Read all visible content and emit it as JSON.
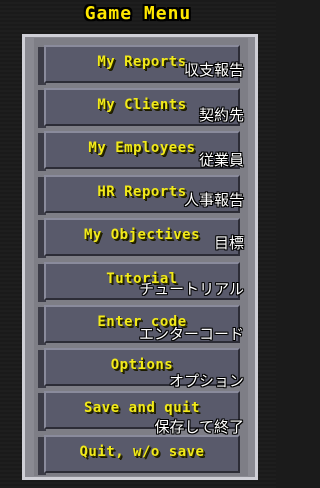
{
  "title": "Game Menu",
  "items": [
    {
      "label": "My Reports",
      "subtitle": "収支報告"
    },
    {
      "label": "My Clients",
      "subtitle": "契約先"
    },
    {
      "label": "My Employees",
      "subtitle": "従業員"
    },
    {
      "label": "HR Reports",
      "subtitle": "人事報告"
    },
    {
      "label": "My Objectives",
      "subtitle": "目標"
    },
    {
      "label": "Tutorial",
      "subtitle": "チュートリアル"
    },
    {
      "label": "Enter code",
      "subtitle": "エンターコード"
    },
    {
      "label": "Options",
      "subtitle": "オプション"
    },
    {
      "label": "Save and quit",
      "subtitle": "保存して終了"
    },
    {
      "label": "Quit, w/o save",
      "subtitle": ""
    }
  ],
  "colors": {
    "title": "#ffe800",
    "button_text": "#f2ea1a",
    "button_bg": "#595a6b",
    "subtitle_text": "#ffffff"
  }
}
